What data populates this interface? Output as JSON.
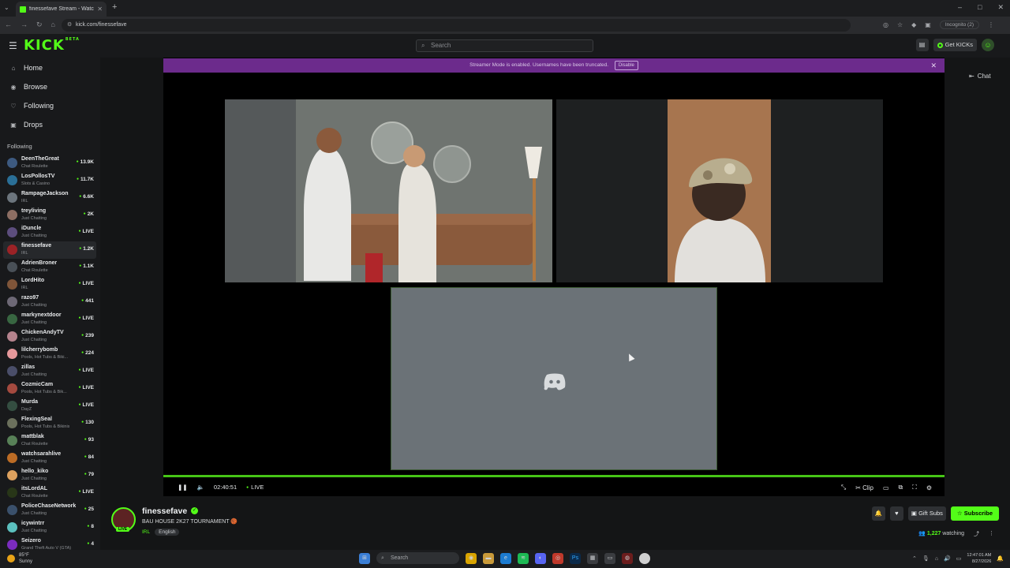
{
  "browser": {
    "tab_title": "finessefave Stream - Watch",
    "url": "kick.com/finessefave",
    "incognito_label": "Incognito (2)"
  },
  "header": {
    "logo": "KICK",
    "logo_sup": "BETA",
    "search_placeholder": "Search",
    "get_kicks": "Get KICKs"
  },
  "sidebar": {
    "nav": [
      {
        "label": "Home",
        "icon": "home-icon"
      },
      {
        "label": "Browse",
        "icon": "compass-icon"
      },
      {
        "label": "Following",
        "icon": "heart-icon"
      },
      {
        "label": "Drops",
        "icon": "gift-icon"
      }
    ],
    "following_heading": "Following",
    "channels": [
      {
        "name": "DeenTheGreat",
        "category": "Chat Roulette",
        "viewers": "13.9K"
      },
      {
        "name": "LosPollosTV",
        "category": "Slots & Casino",
        "viewers": "11.7K"
      },
      {
        "name": "RampageJackson",
        "category": "IRL",
        "viewers": "6.6K"
      },
      {
        "name": "treyliving",
        "category": "Just Chatting",
        "viewers": "2K"
      },
      {
        "name": "iDuncle",
        "category": "Just Chatting",
        "viewers": "LIVE"
      },
      {
        "name": "finessefave",
        "category": "IRL",
        "viewers": "1.2K"
      },
      {
        "name": "AdrienBroner",
        "category": "Chat Roulette",
        "viewers": "1.1K"
      },
      {
        "name": "LordHito",
        "category": "IRL",
        "viewers": "LIVE"
      },
      {
        "name": "razo97",
        "category": "Just Chatting",
        "viewers": "441"
      },
      {
        "name": "markynextdoor",
        "category": "Just Chatting",
        "viewers": "LIVE"
      },
      {
        "name": "ChickenAndyTV",
        "category": "Just Chatting",
        "viewers": "239"
      },
      {
        "name": "lilcherrybomb",
        "category": "Pools, Hot Tubs & Biki...",
        "viewers": "224"
      },
      {
        "name": "zillas",
        "category": "Just Chatting",
        "viewers": "LIVE"
      },
      {
        "name": "CozmicCam",
        "category": "Pools, Hot Tubs & Bik...",
        "viewers": "LIVE"
      },
      {
        "name": "Murda",
        "category": "DayZ",
        "viewers": "LIVE"
      },
      {
        "name": "FlexingSeal",
        "category": "Pools, Hot Tubs & Bikinis",
        "viewers": "130"
      },
      {
        "name": "mattblak",
        "category": "Chat Roulette",
        "viewers": "93"
      },
      {
        "name": "watchsarahlive",
        "category": "Just Chatting",
        "viewers": "84"
      },
      {
        "name": "hello_kiko",
        "category": "Just Chatting",
        "viewers": "79"
      },
      {
        "name": "itsLordAL",
        "category": "Chat Roulette",
        "viewers": "LIVE"
      },
      {
        "name": "PoliceChaseNetwork",
        "category": "Just Chatting",
        "viewers": "25"
      },
      {
        "name": "icywintrr",
        "category": "Just Chatting",
        "viewers": "8"
      },
      {
        "name": "Seizero",
        "category": "Grand Theft Auto V (GTA)",
        "viewers": "4"
      }
    ]
  },
  "player": {
    "banner_text": "Streamer Mode is enabled. Usernames have been truncated.",
    "banner_button": "Disable",
    "chat_label": "Chat",
    "time": "02:40:51",
    "live": "LIVE",
    "clip_label": "Clip"
  },
  "channel": {
    "name": "finessefave",
    "live_badge": "LIVE",
    "title": "BAU HOUSE 2K27 TOURNAMENT 🏀",
    "category": "IRL",
    "tag": "English",
    "gift_subs": "Gift Subs",
    "subscribe": "Subscribe",
    "watching_count": "1,227",
    "watching_label": "watching"
  },
  "taskbar": {
    "weather_temp": "85°F",
    "weather_desc": "Sunny",
    "search": "Search",
    "time": "12:47:01 AM",
    "date": "8/27/2026"
  }
}
